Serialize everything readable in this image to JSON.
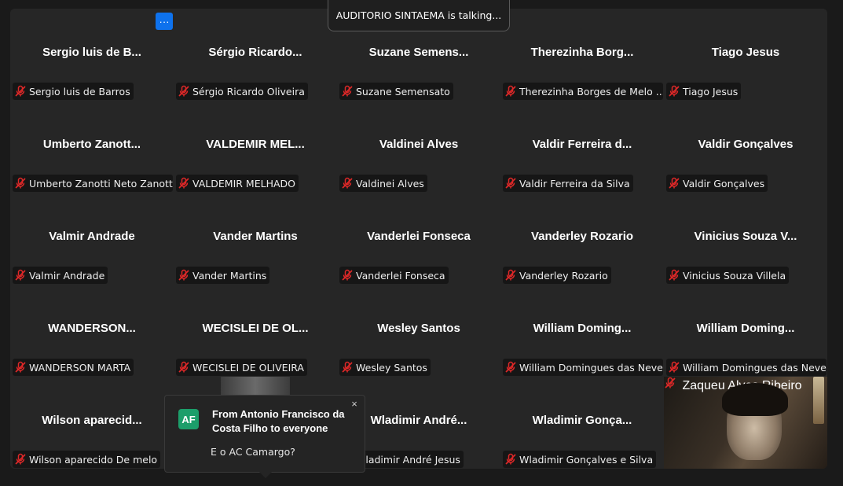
{
  "speaking_banner": "AUDITORIO SINTAEMA is talking...",
  "more_button": "···",
  "tiles": [
    {
      "display": "Sergio luis de B...",
      "name": "Sergio luis de Barros"
    },
    {
      "display": "Sérgio  Ricardo...",
      "name": "Sérgio Ricardo Oliveira"
    },
    {
      "display": "Suzane  Semens...",
      "name": "Suzane Semensato"
    },
    {
      "display": "Therezinha  Borg...",
      "name": "Therezinha Borges de Melo ..."
    },
    {
      "display": "Tiago Jesus",
      "name": "Tiago Jesus"
    },
    {
      "display": "Umberto  Zanott...",
      "name": "Umberto Zanotti Neto Zanotti"
    },
    {
      "display": "VALDEMIR  MEL...",
      "name": "VALDEMIR MELHADO"
    },
    {
      "display": "Valdinei Alves",
      "name": "Valdinei Alves"
    },
    {
      "display": "Valdir  Ferreira  d...",
      "name": "Valdir Ferreira da Silva"
    },
    {
      "display": "Valdir Gonçalves",
      "name": "Valdir Gonçalves"
    },
    {
      "display": "Valmir Andrade",
      "name": "Valmir Andrade"
    },
    {
      "display": "Vander Martins",
      "name": "Vander Martins"
    },
    {
      "display": "Vanderlei Fonseca",
      "name": "Vanderlei Fonseca"
    },
    {
      "display": "Vanderley Rozario",
      "name": "Vanderley Rozario"
    },
    {
      "display": "Vinicius  Souza  V...",
      "name": "Vinicius Souza Villela"
    },
    {
      "display": "WANDERSON...",
      "name": "WANDERSON MARTA"
    },
    {
      "display": "WECISLEI  DE  OL...",
      "name": "WECISLEI DE OLIVEIRA"
    },
    {
      "display": "Wesley Santos",
      "name": "Wesley Santos"
    },
    {
      "display": "William  Doming...",
      "name": "William Domingues das Neves"
    },
    {
      "display": "William  Doming...",
      "name": "William Domingues das Neves"
    },
    {
      "display": "Wilson  aparecid...",
      "name": "Wilson aparecido De melo"
    },
    {
      "display": "",
      "name": ""
    },
    {
      "display": "Wladimir  André...",
      "name": "Wladimir André Jesus"
    },
    {
      "display": "Wladimir  Gonça...",
      "name": "Wladimir Gonçalves e Silva"
    }
  ],
  "video_tile": {
    "name": "Zaqueu Alves Ribeiro"
  },
  "chat_popup": {
    "avatar": "AF",
    "from": "From Antonio Francisco da Costa Filho to everyone",
    "message": "E o AC Camargo?",
    "close": "×"
  },
  "colors": {
    "mic_muted": "#e02828",
    "accent": "#0e72ed",
    "avatar": "#1c9e6a"
  }
}
